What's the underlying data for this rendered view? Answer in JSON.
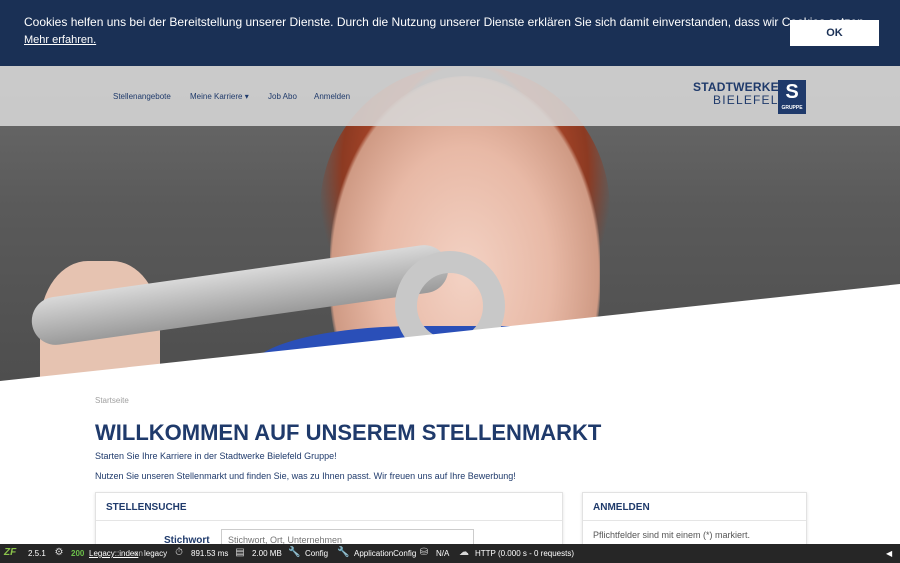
{
  "cookie_banner": {
    "text": "Cookies helfen uns bei der Bereitstellung unserer Dienste. Durch die Nutzung unserer Dienste erklären Sie sich damit einverstanden, dass wir Cookies setzen.",
    "link": "Mehr erfahren.",
    "ok_button": "OK"
  },
  "nav": {
    "items": [
      {
        "label": "Stellenangebote"
      },
      {
        "label": "Meine Karriere ▾"
      },
      {
        "label": "Job Abo"
      },
      {
        "label": "Anmelden"
      }
    ]
  },
  "logo": {
    "line1": "STADTWERKE",
    "line2": "BIELEFELD",
    "badge_letter": "S",
    "badge_text": "GRUPPE"
  },
  "breadcrumb": "Startseite",
  "main": {
    "title": "WILLKOMMEN AUF UNSEREM STELLENMARKT",
    "intro1": "Starten Sie Ihre Karriere in der Stadtwerke Bielefeld Gruppe!",
    "intro2": "Nutzen Sie unseren Stellenmarkt und finden Sie, was zu Ihnen passt. Wir freuen uns auf Ihre Bewerbung!"
  },
  "search_card": {
    "title": "STELLENSUCHE",
    "label": "Stichwort",
    "placeholder": "Stichwort, Ort, Unternehmen"
  },
  "login_card": {
    "title": "ANMELDEN",
    "note": "Pflichtfelder sind mit einem (*) markiert."
  },
  "debug_bar": {
    "zf": "ZF",
    "version": "2.5.1",
    "status": "200",
    "route": "Legacy::index",
    "route_on": "on",
    "route_name": "legacy",
    "time": "891.53 ms",
    "memory": "2.00 MB",
    "config": "Config",
    "app_config": "ApplicationConfig",
    "db": "N/A",
    "http": "HTTP (0.000 s - 0 requests)",
    "collapse": "◀"
  },
  "colors": {
    "primary": "#1f3a6b",
    "cookie_bg": "#1a3055",
    "debug_bg": "#262626",
    "status_ok": "#6cc04a"
  }
}
